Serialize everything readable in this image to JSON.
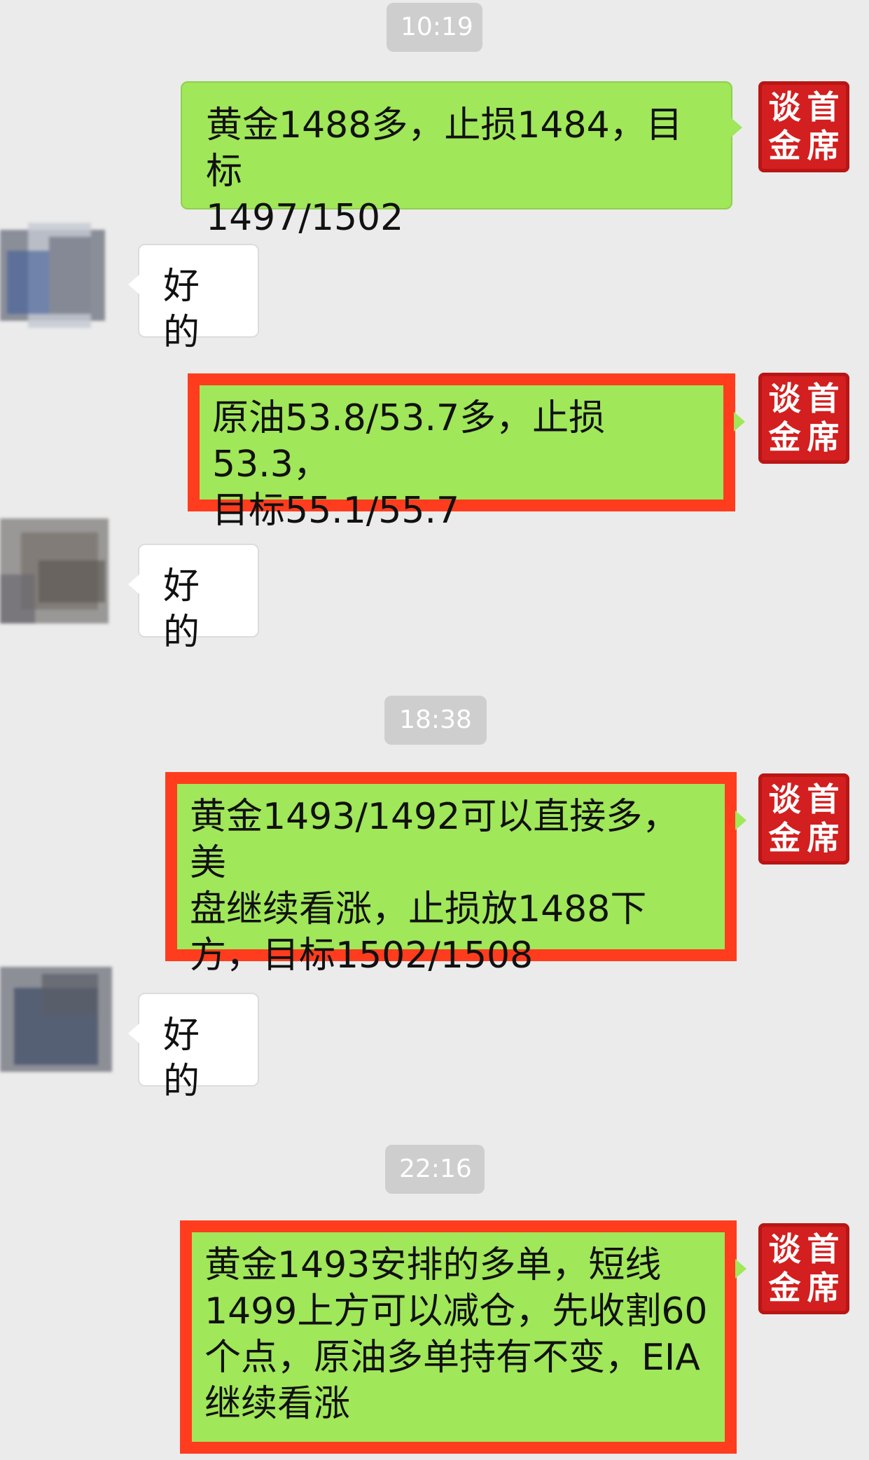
{
  "timestamps": [
    "10:19",
    "18:38",
    "22:16"
  ],
  "seal_chars": [
    "谈",
    "首",
    "金",
    "席"
  ],
  "colors": {
    "background": "#ebebeb",
    "my_bubble": "#a0e759",
    "highlight_border": "#ff3d1e",
    "seal": "#d31f1f"
  },
  "messages": [
    {
      "side": "me",
      "lines": [
        "黄金1488多，止损1484，目标",
        "1497/1502"
      ]
    },
    {
      "side": "them",
      "lines": [
        "好的"
      ]
    },
    {
      "side": "me",
      "highlighted": true,
      "lines": [
        "原油53.8/53.7多，止损53.3，",
        "目标55.1/55.7"
      ]
    },
    {
      "side": "them",
      "lines": [
        "好的"
      ]
    },
    {
      "side": "me",
      "highlighted": true,
      "lines": [
        "黄金1493/1492可以直接多，美",
        "盘继续看涨，止损放1488下",
        "方，目标1502/1508"
      ]
    },
    {
      "side": "them",
      "lines": [
        "好的"
      ]
    },
    {
      "side": "me",
      "highlighted": true,
      "lines": [
        "黄金1493安排的多单，短线",
        "1499上方可以减仓，先收割60",
        "个点，原油多单持有不变，EIA",
        "继续看涨"
      ]
    }
  ]
}
